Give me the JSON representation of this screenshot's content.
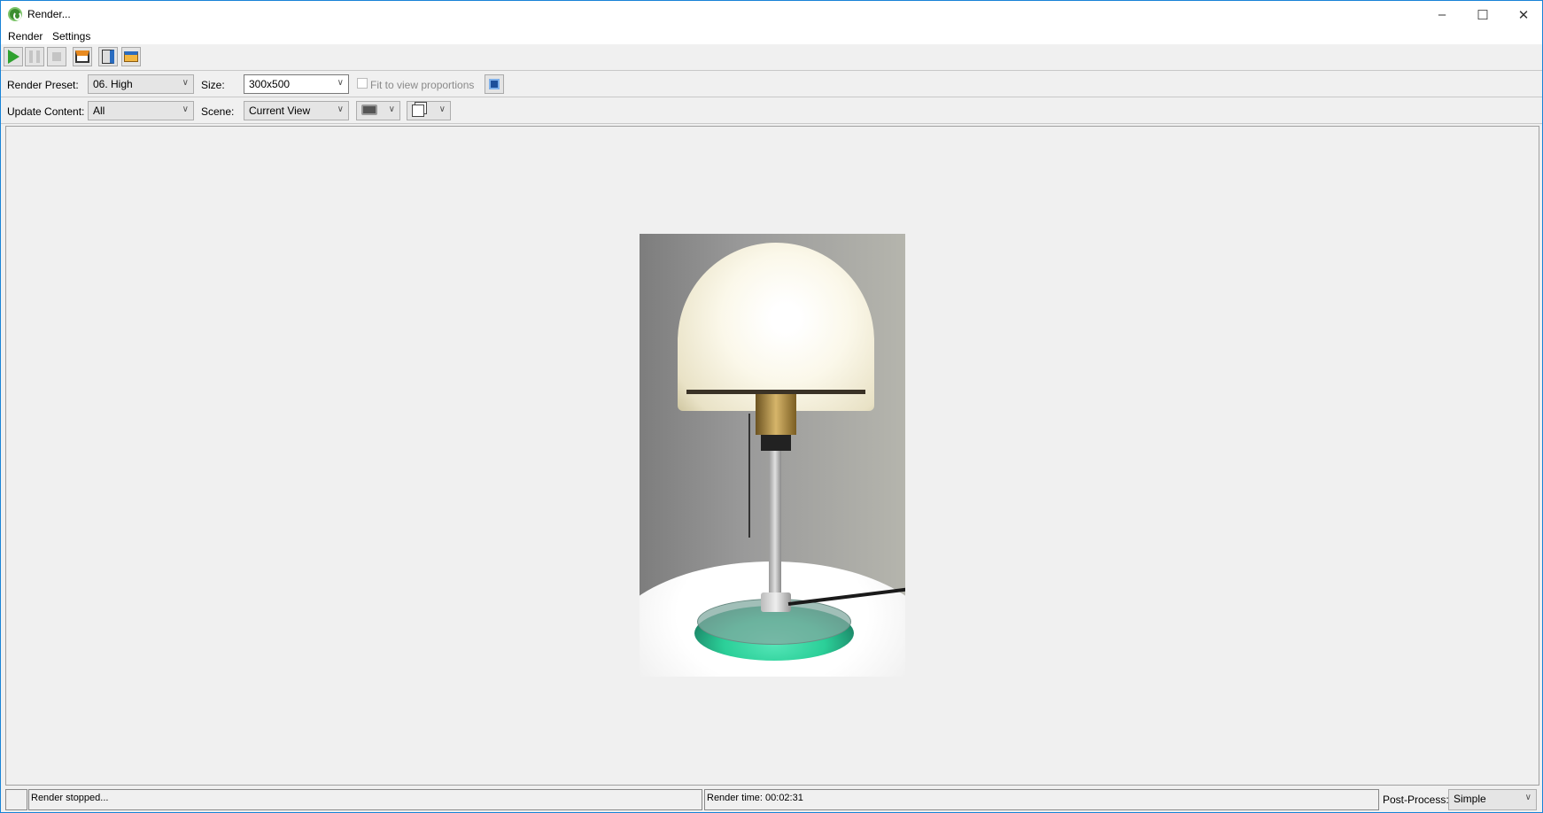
{
  "window": {
    "title": "Render...",
    "minimize": "–",
    "maximize": "☐",
    "close": "✕"
  },
  "menu": [
    "Render",
    "Settings"
  ],
  "toolbar": {
    "icons": [
      "play-icon",
      "pause-icon",
      "stop-icon",
      "save-image-icon",
      "export-icon",
      "package-icon"
    ]
  },
  "row1": {
    "preset_label": "Render Preset:",
    "preset_value": "06. High",
    "size_label": "Size:",
    "size_value": "300x500",
    "fit_label": "Fit to view proportions",
    "fit_checked": false
  },
  "row2": {
    "update_label": "Update Content:",
    "update_value": "All",
    "scene_label": "Scene:",
    "scene_value": "Current View"
  },
  "status": {
    "message": "Render stopped...",
    "time": "Render time: 00:02:31",
    "postprocess_label": "Post-Process:",
    "postprocess_value": "Simple"
  },
  "colors": {
    "accent": "#1883d7",
    "play": "#2fa12f"
  }
}
